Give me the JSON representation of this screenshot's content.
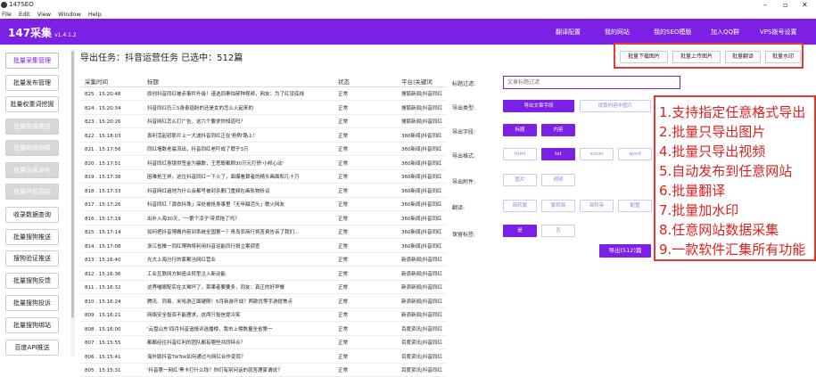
{
  "window": {
    "title": "147SEO",
    "min_symbol": "–",
    "max_symbol": "▫",
    "close_symbol": "✕"
  },
  "menu": [
    "File",
    "Edit",
    "View",
    "Window",
    "Help"
  ],
  "header": {
    "brand": "147采集",
    "version": "v1.4.1.2",
    "nav": [
      "翻译配置",
      "我的网站",
      "我的SEO模版",
      "加入QQ群",
      "VPS拨号设置"
    ]
  },
  "sidebar": [
    {
      "label": "批量采集管理",
      "state": "active"
    },
    {
      "label": "批量发布管理",
      "state": "normal"
    },
    {
      "label": "批量权重词挖掘",
      "state": "normal"
    },
    {
      "label": "批量链接推送",
      "state": "disabled"
    },
    {
      "label": "批量超级链接",
      "state": "disabled"
    },
    {
      "label": "批量伪原发布",
      "state": "disabled"
    },
    {
      "label": "批量伴侣监控",
      "state": "disabled"
    },
    {
      "label": "收录数据查询",
      "state": "normal"
    },
    {
      "label": "批量搜狗推送",
      "state": "normal"
    },
    {
      "label": "搜狗验证推送",
      "state": "normal"
    },
    {
      "label": "批量搜狗反馈",
      "state": "normal"
    },
    {
      "label": "批量搜狗投诉",
      "state": "normal"
    },
    {
      "label": "批量搜狗绑站",
      "state": "normal"
    },
    {
      "label": "百度API推送",
      "state": "normal"
    }
  ],
  "page_title": "导出任务：抖音运营任务 已选中：512篇",
  "toolbar": [
    "批量下载图片",
    "批量上传图片",
    "批量翻译",
    "批量水印"
  ],
  "table": {
    "headers": [
      "采集时间",
      "标题",
      "状态",
      "平台|关键词"
    ],
    "rows": [
      [
        "825 . 15:20:48",
        "原创抖音同红被赤事件升级！谨选同奉怕郝种视频，网友：为了红没底线",
        "正常",
        "搜狐新闻|抖音同红"
      ],
      [
        "824 . 15:20:34",
        "抖音同红仍三5身患癌盼的还是女的怎么火起来的",
        "正常",
        "搜狐新闻|抖音同红"
      ],
      [
        "823 . 15:20:26",
        "抖音网红怎么打广告，这六个要求你知道吗？",
        "正常",
        "搜狐新闻|抖音同红"
      ],
      [
        "822 . 15:18:03",
        "真利活起初那片上一大波抖音同红正在'抢购'路上！",
        "正常",
        "360新闻|抖音同红"
      ],
      [
        "821 . 15:17:56",
        "同红墙数老晨流出，抖音同红老吓成了脖子3万",
        "正常",
        "360新闻|抖音同红"
      ],
      [
        "820 . 15:17:51",
        "抖音同红身镜供签金为骗数，王思聪都顾30万元打债'小邦心动'",
        "正常",
        "360新闻|抖音同红"
      ],
      [
        "819 . 15:17:38",
        "困难抢王祥，这位抖音同红一下火了，面爆看算者的精头画面和几十万",
        "正常",
        "360新闻|抖音同红"
      ],
      [
        "818 . 15:17:33",
        "抖音网红遍地为什么会都号被封杀删门重频在画轨物折议",
        "正常",
        "360新闻|抖音同红"
      ],
      [
        "817 . 15:17:26",
        "抖音同红「源衣抖珠」深处被抢身事里「无甲甜活头」歌火网友",
        "正常",
        "360新闻|抖音同红"
      ],
      [
        "816 . 15:17:19",
        "出补入海30天，'一第个凉子'带货拖了吗？",
        "正常",
        "360新闻|抖音同红"
      ],
      [
        "815 . 15:17:14",
        "如何把抖音博搬内容到系统全国第一？青岛农商行将答费告诉了我们...",
        "正常",
        "360新闻|抖音同红"
      ],
      [
        "814 . 15:17:08",
        "浙江省推一同红博购将利用抖音运能同行损立案调查",
        "正常",
        "360新闻|抖音同红"
      ],
      [
        "813 . 15:16:40",
        "光大上海分行的家都当网红营业",
        "正常",
        "新浪新闻|抖音同红"
      ],
      [
        "812 . 15:16:36",
        "工业互联网方制造业转型注入新动能",
        "正常",
        "新浪新闻|抖音同红"
      ],
      [
        "811 . 15:16:32",
        "这界喵眼配实在太难坏了，菜果者要要多，同友：真正的好早餐",
        "正常",
        "新浪新闻|抖音同红"
      ],
      [
        "810 . 15:16:24",
        "腾讯、同易、米哈游正面硬刚！5月新游开战？两款优等手游提焦点",
        "正常",
        "新浪新闻|抖音同红"
      ],
      [
        "809 . 15:16:21",
        "网络安全投资不能理求，这两只投信提冷笑",
        "正常",
        "新浪新闻|抖音同红"
      ],
      [
        "808 . 15:16:00",
        "'云盘山东'四月抖音追报评选播榜，我市上榜数量全省第一",
        "正常",
        "百度资讯|抖音同红"
      ],
      [
        "807 . 15:15:55",
        "都都经往抖音红利的团队都有哪些共同特点？",
        "正常",
        "百度资讯|抖音同红"
      ],
      [
        "806 . 15:15:41",
        "海外版抖音TikTok如何通过与网红合作变现？",
        "正常",
        "百度资讯|抖音同红"
      ],
      [
        "805 . 15:15:31",
        "'抖音第一网红'黑卡打什么钱？你们有别问话的就答理家谓说？",
        "正常",
        "百度资讯|抖音同红"
      ]
    ]
  },
  "form": {
    "filter_label": "标题过滤:",
    "filter_placeholder": "文章标题过滤",
    "type_label": "导出类型:",
    "type_options": [
      "导出文章字段",
      "提取内容中图片"
    ],
    "field_label": "导出字段:",
    "field_options": [
      "标题",
      "内容"
    ],
    "format_label": "导出格式:",
    "format_options": [
      "html",
      "txt",
      "excel",
      "word"
    ],
    "attach_label": "导出附件:",
    "attach_options": [
      "图片",
      "视频"
    ],
    "translate_label": "翻译:",
    "translate_options": [
      "简转繁",
      "繁转简",
      "简转英",
      "配置"
    ],
    "keep_label": "保留标签:",
    "keep_options": [
      "是",
      "否"
    ],
    "export_button": "导出(512)篇"
  },
  "features": [
    "1.支持指定任意格式导出",
    "2.批量只导出图片",
    "4.批量只导出视频",
    "5.自动发布到任意网站",
    "6.批量翻译",
    "7.批量加水印",
    "8.任意网站数据采集",
    "9.一款软件汇集所有功能"
  ],
  "colors": {
    "accent": "#7c20e6",
    "highlight": "#e53935"
  }
}
